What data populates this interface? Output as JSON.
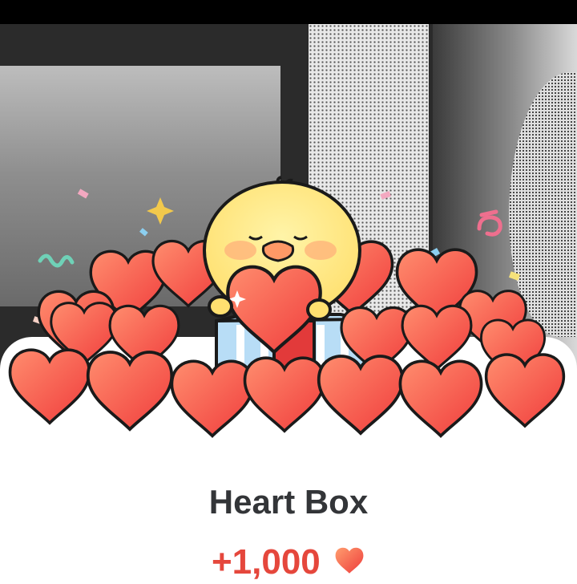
{
  "reward_card": {
    "title": "Heart Box",
    "reward_amount": "+1,000",
    "reward_icon": "heart-icon",
    "accent_color": "#e5473c"
  },
  "illustration": {
    "character": "chick-holding-heart",
    "heart_color": "#f25a44"
  }
}
